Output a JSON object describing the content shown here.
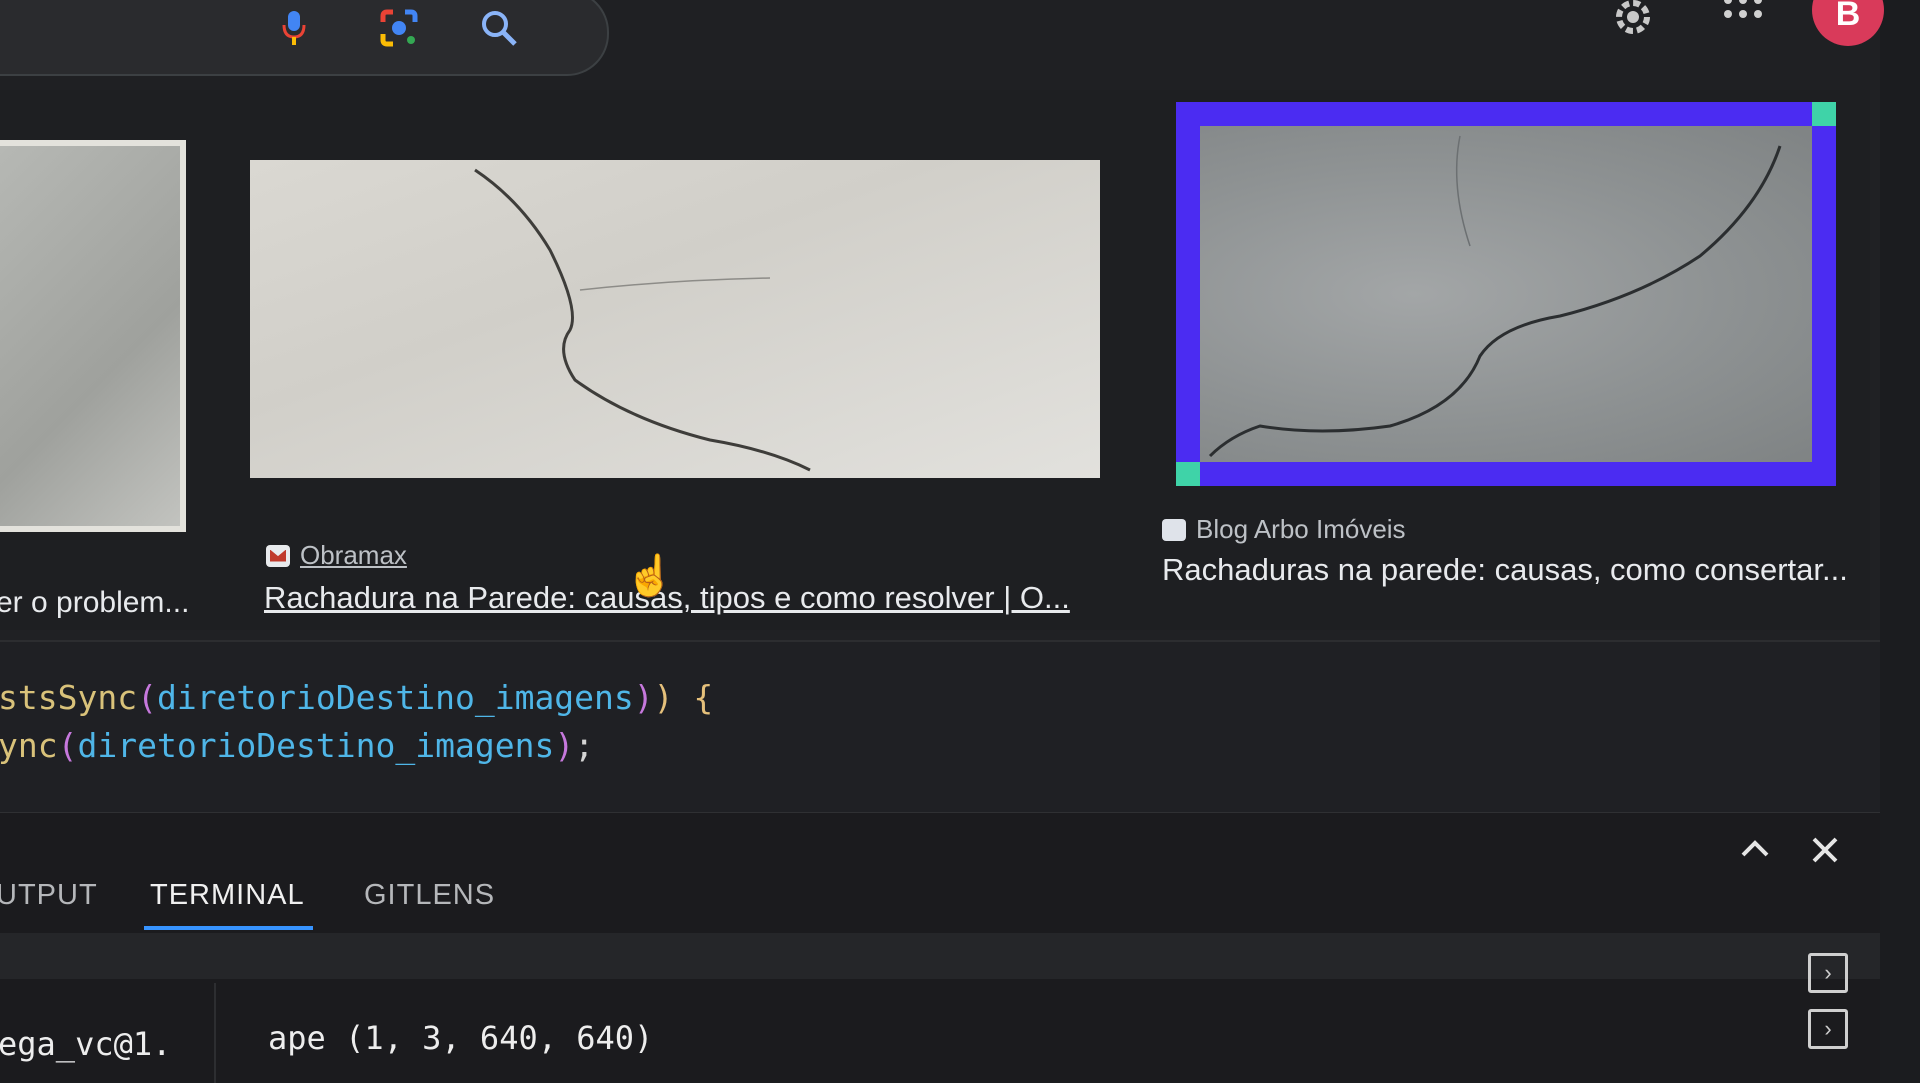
{
  "search": {
    "icons": [
      "mic-icon",
      "google-lens-icon",
      "search-icon"
    ]
  },
  "header": {
    "avatar_letter": "B",
    "icons": [
      "settings-gear-icon",
      "apps-grid-icon"
    ]
  },
  "results": [
    {
      "title": "er o problem..."
    },
    {
      "source": "Obramax",
      "title": "Rachadura na Parede: causas, tipos e como resolver | O..."
    },
    {
      "source": "Blog Arbo Imóveis",
      "title": "Rachaduras na parede: causas, como consertar..."
    }
  ],
  "editor": {
    "line1": {
      "fn": "stsSync",
      "open": "(",
      "arg": "diretorioDestino_imagens",
      "close": ")",
      "close2": ")",
      "tail": " {"
    },
    "line2": {
      "fn": "ync",
      "open": "(",
      "arg": "diretorioDestino_imagens",
      "close": ")",
      "tail": ";"
    }
  },
  "panel": {
    "tabs": [
      {
        "label": "UTPUT"
      },
      {
        "label": "TERMINAL"
      },
      {
        "label": "GITLENS"
      }
    ],
    "terminal_left": "ega_vc@1.",
    "terminal_output": "ape (1, 3, 640, 640)"
  },
  "colors": {
    "selection_border": "#4b2cf2",
    "selection_handle": "#3fd3a8",
    "tab_active_underline": "#3794ff",
    "avatar_bg": "#d93a5a"
  }
}
